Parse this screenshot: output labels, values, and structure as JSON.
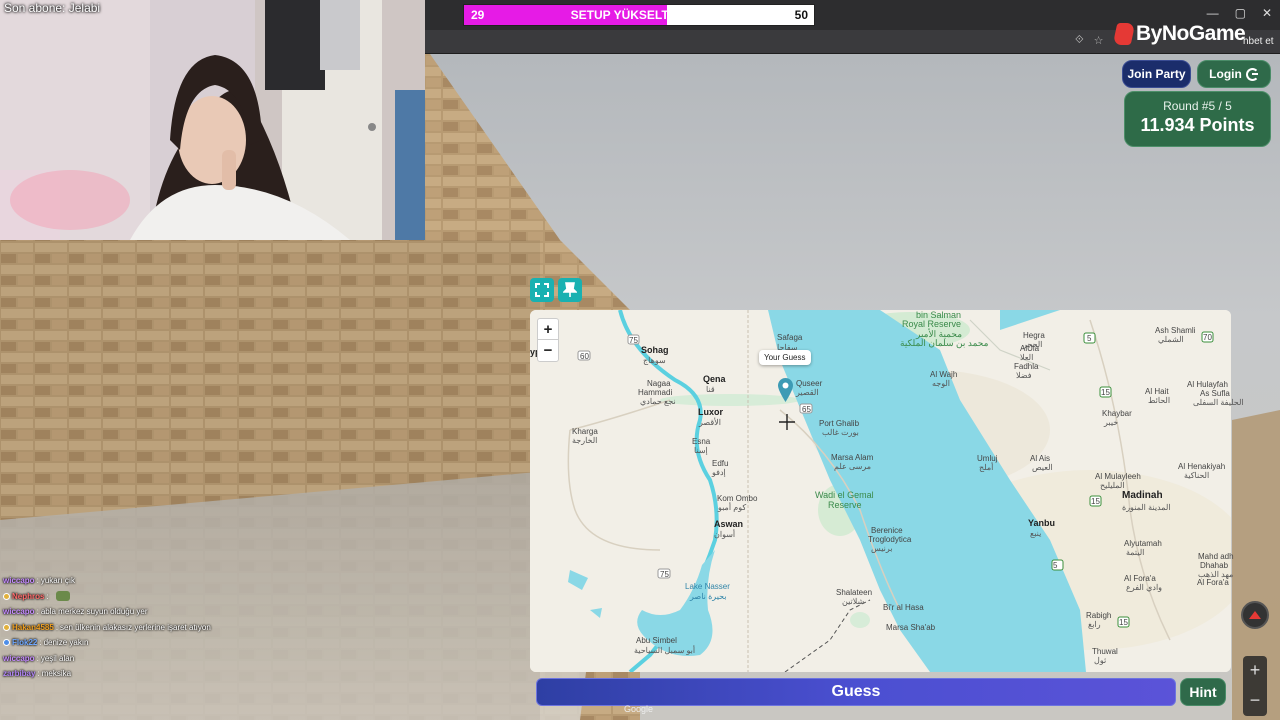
{
  "stream": {
    "last_subscriber": "Son abone: Jelabi"
  },
  "goal": {
    "current": "29",
    "target": "50",
    "title": "SETUP YÜKSELTELIMM",
    "progress": 0.58,
    "color": "#e61be6"
  },
  "browser": {
    "sponsor_brand": "ByNoGame",
    "sponsor_suffix": "hbet et",
    "window_controls": [
      "—",
      "▢",
      "✕"
    ]
  },
  "game": {
    "join_party": "Join Party",
    "login": "Login",
    "round": "Round #5 / 5",
    "points": "11.934 Points",
    "guess_button": "Guess",
    "hint_button": "Hint",
    "attribution": "Google",
    "guess_tooltip": "Your Guess",
    "accent_green": "#2e6b48",
    "accent_purple": "#4b4fd1"
  },
  "map": {
    "zoom_in": "+",
    "zoom_out": "−",
    "labels": {
      "sohag": "Sohag",
      "sohag_ar": "سوهاج",
      "qena": "Qena",
      "qena_ar": "قنا",
      "nagaa": "Nagaa",
      "hammadi": "Hammadi",
      "hammadi_ar": "نجع حمادي",
      "luxor": "Luxor",
      "luxor_ar": "الأقصر",
      "kharga": "Kharga",
      "kharga_ar": "الخارجة",
      "esna": "Esna",
      "esna_ar": "إسنا",
      "edfu": "Edfu",
      "edfu_ar": "إدفو",
      "kom_ombo": "Kom Ombo",
      "kom_ombo_ar": "كوم أمبو",
      "aswan": "Aswan",
      "aswan_ar": "أسوان",
      "lake_nasser": "Lake Nasser",
      "lake_nasser_ar": "بحيرة ناصر",
      "abu_simbel": "Abu Simbel",
      "abu_simbel_ar": "أبو سمبل السياحية",
      "safaga": "Safaga",
      "safaga_ar": "سفاجا",
      "quseer": "Quseer",
      "quseer_ar": "القصير",
      "port_ghalib": "Port Ghalib",
      "port_ghalib_ar": "بورت غالب",
      "marsa_alam": "Marsa Alam",
      "marsa_alam_ar": "مرسى علم",
      "wadi_gemal": "Wadi el Gemal",
      "wadi_gemal_reserve": "Reserve",
      "berenice": "Berenice",
      "troglodytica": "Troglodytica",
      "berenice_ar": "برنيس",
      "shalateen": "Shalateen",
      "shalateen_ar": "شلاتين",
      "bir_al_hasa": "Bi'r al Hasa",
      "marsa_shaab": "Marsa Sha'ab",
      "bin_salman": "bin Salman",
      "royal_reserve": "Royal Reserve",
      "royal_reserve_ar": "محمية الأمير",
      "royal_reserve_ar2": "محمد بن سلمان الملكية",
      "hegra": "Hegra",
      "hegra_ar": "الحجر",
      "ula": "AlUla",
      "ula_ar": "العلا",
      "fadhla": "Fadhla",
      "fadhla_ar": "فضلا",
      "al_wajh": "Al Wajh",
      "al_wajh_ar": "الوجه",
      "ash_shamli": "Ash Shamli",
      "ash_shamli_ar": "الشملي",
      "al_hait": "Al Hait",
      "al_hait_ar": "الحائط",
      "al_hulayfah": "Al Hulayfah",
      "al_hulayfah2": "As Sufla",
      "al_hulayfah_ar": "الحليفة السفلى",
      "khaybar": "Khaybar",
      "khaybar_ar": "خيبر",
      "umluj": "Umluj",
      "umluj_ar": "أملج",
      "al_ais": "Al Ais",
      "al_ais_ar": "العيص",
      "al_hunakiyah": "Al Henakiyah",
      "al_hunakiyah_ar": "الحناكية",
      "al_mulayleeh": "Al Mulayleeh",
      "al_mulayleeh_ar": "المليليح",
      "madinah": "Madinah",
      "madinah_ar": "المدينة المنورة",
      "yanbu": "Yanbu",
      "yanbu_ar": "ينبع",
      "alyutamah": "Alyutamah",
      "alyutamah_ar": "اليتمة",
      "mahd": "Mahd adh",
      "mahd2": "Dhahab",
      "mahd_ar": "مهد الذهب",
      "al_fura": "Al Fora'a",
      "al_fura2": "Al Fora'a",
      "al_fura_ar": "وادي الفرع",
      "rabigh": "Rabigh",
      "rabigh_ar": "رابغ",
      "thuwal": "Thuwal",
      "thuwal_ar": "ثول",
      "yp": "yp",
      "r60": "60",
      "r75": "75",
      "r65": "65",
      "r5": "5",
      "r15": "15",
      "r70": "70"
    }
  },
  "chat": [
    {
      "user": "wiccapo",
      "message": "yukarı çık",
      "color": "#c58cff",
      "badge": ""
    },
    {
      "user": "Nephros",
      "message": "",
      "color": "#ff6b6b",
      "badge": "gold",
      "emote": true
    },
    {
      "user": "wiccapo",
      "message": "abla merkez suyun olduğu yer",
      "color": "#c58cff",
      "badge": ""
    },
    {
      "user": "Hakan4585",
      "message": "sen ülkenin alakasız yerlerine işaret atıyon",
      "color": "#f0a020",
      "badge": "gold"
    },
    {
      "user": "Flok22",
      "message": "denize yakın",
      "color": "#6fa8ff",
      "badge": "blue"
    },
    {
      "user": "wiccapo",
      "message": "yeşil alan",
      "color": "#c58cff",
      "badge": ""
    },
    {
      "user": "zarbibay",
      "message": "meksika",
      "color": "#b084f5",
      "badge": ""
    }
  ]
}
